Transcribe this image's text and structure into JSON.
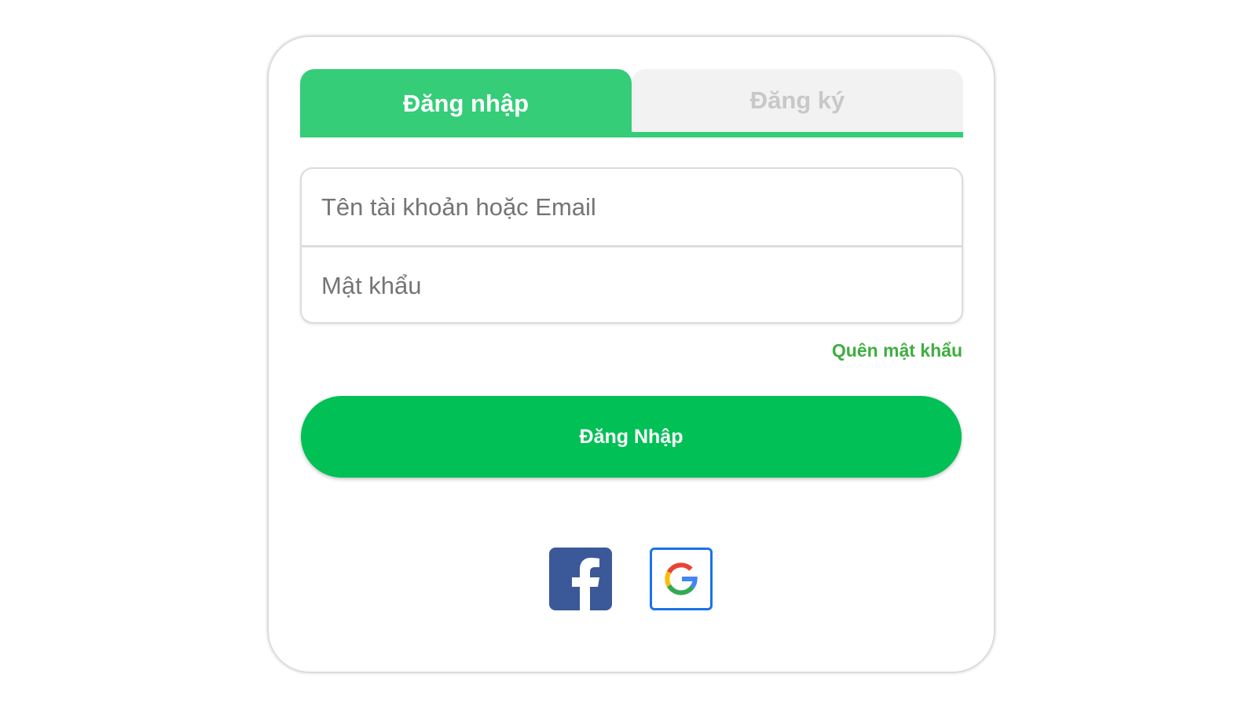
{
  "tabs": {
    "login_label": "Đăng nhập",
    "register_label": "Đăng ký"
  },
  "form": {
    "username_placeholder": "Tên tài khoản hoặc Email",
    "username_value": "",
    "password_placeholder": "Mật khẩu",
    "password_value": "",
    "forgot_label": "Quên mật khẩu",
    "submit_label": "Đăng Nhập"
  },
  "social": {
    "facebook_icon": "facebook-icon",
    "google_icon": "google-icon"
  },
  "colors": {
    "accent": "#35cd78",
    "button": "#00c056",
    "link": "#3fae3f",
    "facebook": "#3b5998",
    "google_border": "#1a73e8"
  }
}
